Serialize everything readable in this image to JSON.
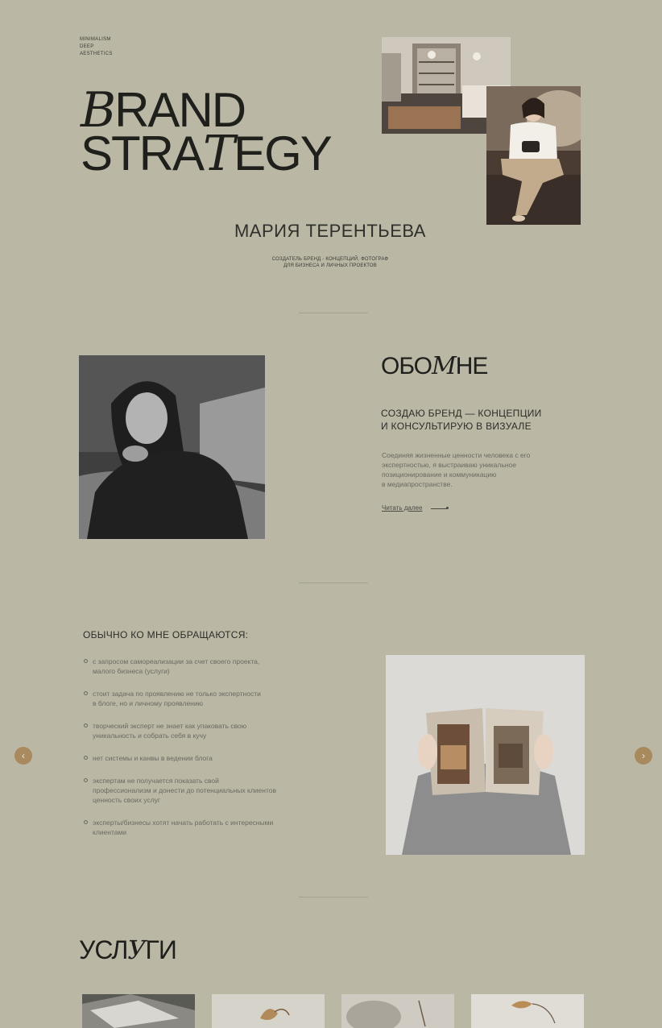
{
  "hero": {
    "tagline": [
      "MINIMALISM",
      "DEEP",
      "AESTHETICS"
    ],
    "title_line1_script": "B",
    "title_line1_rest": "RAND",
    "title_line2_a": "STRA",
    "title_line2_script": "T",
    "title_line2_b": "EGY",
    "name": "МАРИЯ ТЕРЕНТЬЕВА",
    "subtitle_line1": "СОЗДАТЕЛЬ БРЕНД - КОНЦЕПЦИЙ, ФОТОГРАФ",
    "subtitle_line2": "ДЛЯ БИЗНЕСА И ЛИЧНЫХ ПРОЕКТОВ"
  },
  "about": {
    "heading_a": "ОБО",
    "heading_script": "М",
    "heading_b": "НЕ",
    "sub_line1": "СОЗДАЮ БРЕНД — КОНЦЕПЦИИ",
    "sub_line2": "И КОНСУЛЬТИРУЮ В ВИЗУАЛЕ",
    "text_lines": [
      "Соединяя жизненные ценности человека с его",
      "экспертностью, я выстраиваю уникальное",
      "позиционирование и коммуникацию",
      "в медиапространстве."
    ],
    "read_more": "Читать далее"
  },
  "clients": {
    "heading": "ОБЫЧНО КО МНЕ ОБРАЩАЮТСЯ:",
    "items": [
      [
        "с запросом самореализации за счет своего проекта,",
        "малого бизнеса (услуги)"
      ],
      [
        "стоит задача по проявлению не только экспертности",
        "в блоге, но и личному проявлению"
      ],
      [
        "творческий эксперт не знает как упаковать свою",
        "уникальность и собрать себя в кучу"
      ],
      [
        "нет системы и канвы в ведении блога"
      ],
      [
        "экспертам не получается показать свой",
        "профессионализм и донести до потенциальных клиентов",
        "ценность своих услуг"
      ],
      [
        "эксперты/бизнесы хотят начать работать с интересными",
        "клиентами"
      ]
    ]
  },
  "carousel": {
    "prev_icon": "chevron-left-icon",
    "prev": "‹",
    "next_icon": "chevron-right-icon",
    "next": "›"
  },
  "services": {
    "heading_a": "УСЛ",
    "heading_script": "У",
    "heading_b": "ГИ"
  },
  "colors": {
    "background": "#bab8a5",
    "accent": "#a98a5e",
    "text": "#2a2a26",
    "muted": "#6a6960"
  }
}
